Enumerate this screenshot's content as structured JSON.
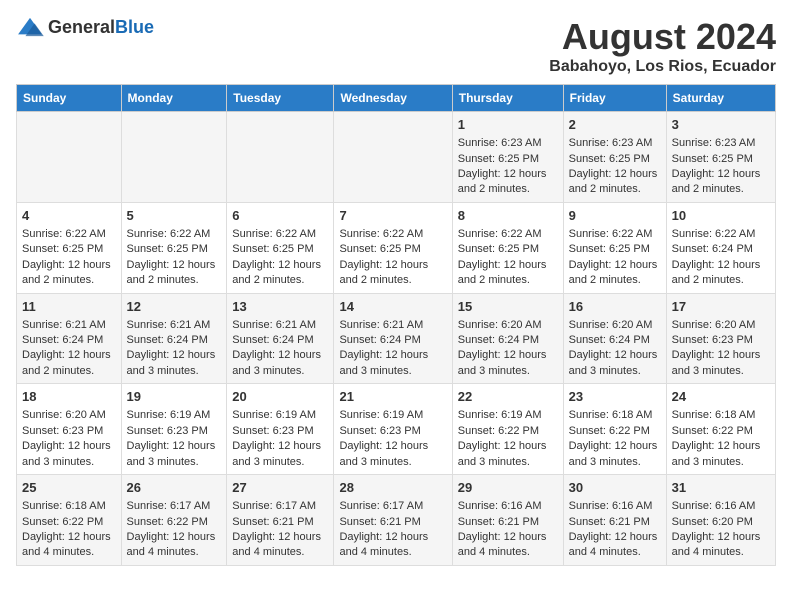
{
  "logo": {
    "general": "General",
    "blue": "Blue"
  },
  "title": "August 2024",
  "subtitle": "Babahoyo, Los Rios, Ecuador",
  "headers": [
    "Sunday",
    "Monday",
    "Tuesday",
    "Wednesday",
    "Thursday",
    "Friday",
    "Saturday"
  ],
  "weeks": [
    [
      {
        "day": "",
        "info": ""
      },
      {
        "day": "",
        "info": ""
      },
      {
        "day": "",
        "info": ""
      },
      {
        "day": "",
        "info": ""
      },
      {
        "day": "1",
        "info": "Sunrise: 6:23 AM\nSunset: 6:25 PM\nDaylight: 12 hours and 2 minutes."
      },
      {
        "day": "2",
        "info": "Sunrise: 6:23 AM\nSunset: 6:25 PM\nDaylight: 12 hours and 2 minutes."
      },
      {
        "day": "3",
        "info": "Sunrise: 6:23 AM\nSunset: 6:25 PM\nDaylight: 12 hours and 2 minutes."
      }
    ],
    [
      {
        "day": "4",
        "info": "Sunrise: 6:22 AM\nSunset: 6:25 PM\nDaylight: 12 hours and 2 minutes."
      },
      {
        "day": "5",
        "info": "Sunrise: 6:22 AM\nSunset: 6:25 PM\nDaylight: 12 hours and 2 minutes."
      },
      {
        "day": "6",
        "info": "Sunrise: 6:22 AM\nSunset: 6:25 PM\nDaylight: 12 hours and 2 minutes."
      },
      {
        "day": "7",
        "info": "Sunrise: 6:22 AM\nSunset: 6:25 PM\nDaylight: 12 hours and 2 minutes."
      },
      {
        "day": "8",
        "info": "Sunrise: 6:22 AM\nSunset: 6:25 PM\nDaylight: 12 hours and 2 minutes."
      },
      {
        "day": "9",
        "info": "Sunrise: 6:22 AM\nSunset: 6:25 PM\nDaylight: 12 hours and 2 minutes."
      },
      {
        "day": "10",
        "info": "Sunrise: 6:22 AM\nSunset: 6:24 PM\nDaylight: 12 hours and 2 minutes."
      }
    ],
    [
      {
        "day": "11",
        "info": "Sunrise: 6:21 AM\nSunset: 6:24 PM\nDaylight: 12 hours and 2 minutes."
      },
      {
        "day": "12",
        "info": "Sunrise: 6:21 AM\nSunset: 6:24 PM\nDaylight: 12 hours and 3 minutes."
      },
      {
        "day": "13",
        "info": "Sunrise: 6:21 AM\nSunset: 6:24 PM\nDaylight: 12 hours and 3 minutes."
      },
      {
        "day": "14",
        "info": "Sunrise: 6:21 AM\nSunset: 6:24 PM\nDaylight: 12 hours and 3 minutes."
      },
      {
        "day": "15",
        "info": "Sunrise: 6:20 AM\nSunset: 6:24 PM\nDaylight: 12 hours and 3 minutes."
      },
      {
        "day": "16",
        "info": "Sunrise: 6:20 AM\nSunset: 6:24 PM\nDaylight: 12 hours and 3 minutes."
      },
      {
        "day": "17",
        "info": "Sunrise: 6:20 AM\nSunset: 6:23 PM\nDaylight: 12 hours and 3 minutes."
      }
    ],
    [
      {
        "day": "18",
        "info": "Sunrise: 6:20 AM\nSunset: 6:23 PM\nDaylight: 12 hours and 3 minutes."
      },
      {
        "day": "19",
        "info": "Sunrise: 6:19 AM\nSunset: 6:23 PM\nDaylight: 12 hours and 3 minutes."
      },
      {
        "day": "20",
        "info": "Sunrise: 6:19 AM\nSunset: 6:23 PM\nDaylight: 12 hours and 3 minutes."
      },
      {
        "day": "21",
        "info": "Sunrise: 6:19 AM\nSunset: 6:23 PM\nDaylight: 12 hours and 3 minutes."
      },
      {
        "day": "22",
        "info": "Sunrise: 6:19 AM\nSunset: 6:22 PM\nDaylight: 12 hours and 3 minutes."
      },
      {
        "day": "23",
        "info": "Sunrise: 6:18 AM\nSunset: 6:22 PM\nDaylight: 12 hours and 3 minutes."
      },
      {
        "day": "24",
        "info": "Sunrise: 6:18 AM\nSunset: 6:22 PM\nDaylight: 12 hours and 3 minutes."
      }
    ],
    [
      {
        "day": "25",
        "info": "Sunrise: 6:18 AM\nSunset: 6:22 PM\nDaylight: 12 hours and 4 minutes."
      },
      {
        "day": "26",
        "info": "Sunrise: 6:17 AM\nSunset: 6:22 PM\nDaylight: 12 hours and 4 minutes."
      },
      {
        "day": "27",
        "info": "Sunrise: 6:17 AM\nSunset: 6:21 PM\nDaylight: 12 hours and 4 minutes."
      },
      {
        "day": "28",
        "info": "Sunrise: 6:17 AM\nSunset: 6:21 PM\nDaylight: 12 hours and 4 minutes."
      },
      {
        "day": "29",
        "info": "Sunrise: 6:16 AM\nSunset: 6:21 PM\nDaylight: 12 hours and 4 minutes."
      },
      {
        "day": "30",
        "info": "Sunrise: 6:16 AM\nSunset: 6:21 PM\nDaylight: 12 hours and 4 minutes."
      },
      {
        "day": "31",
        "info": "Sunrise: 6:16 AM\nSunset: 6:20 PM\nDaylight: 12 hours and 4 minutes."
      }
    ]
  ]
}
